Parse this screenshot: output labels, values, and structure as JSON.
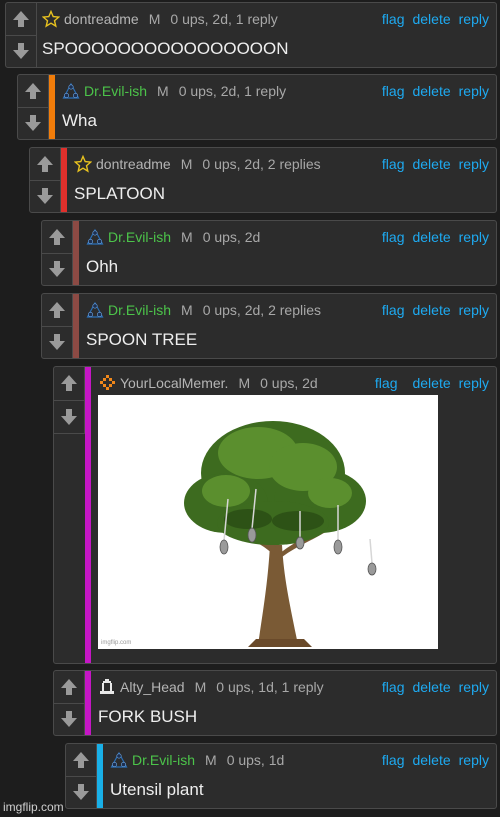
{
  "actions": {
    "flag": "flag",
    "delete": "delete",
    "reply": "reply"
  },
  "colors": {
    "background": "#1d1d1d",
    "panel": "#2c2c2c",
    "link": "#1eaaf1",
    "username_green": "#4cc44a",
    "bar_orange": "#f27d0a",
    "bar_red": "#e0302c",
    "bar_brown": "#8c4a44",
    "bar_magenta": "#c516c5",
    "bar_cyan": "#19b0e8"
  },
  "comments": [
    {
      "user": "dontreadme",
      "role": "M",
      "stats": "0 ups, 2d, 1 reply",
      "text": "SPOOOOOOOOOOOOOOOON",
      "avatar": "star-outline-icon"
    },
    {
      "user": "Dr.Evil-ish",
      "role": "M",
      "stats": "0 ups, 2d, 1 reply",
      "text": "Wha",
      "avatar": "triangle-stars-icon"
    },
    {
      "user": "dontreadme",
      "role": "M",
      "stats": "0 ups, 2d, 2 replies",
      "text": "SPLATOON",
      "avatar": "star-outline-icon"
    },
    {
      "user": "Dr.Evil-ish",
      "role": "M",
      "stats": "0 ups, 2d",
      "text": "Ohh",
      "avatar": "triangle-stars-icon"
    },
    {
      "user": "Dr.Evil-ish",
      "role": "M",
      "stats": "0 ups, 2d, 2 replies",
      "text": "SPOON TREE",
      "avatar": "triangle-stars-icon"
    },
    {
      "user": "YourLocalMemer.",
      "role": "M",
      "stats": "0 ups, 2d",
      "image_watermark": "imgflip.com",
      "avatar": "pixel-diamond-icon"
    },
    {
      "user": "Alty_Head",
      "role": "M",
      "stats": "0 ups, 1d, 1 reply",
      "text": "FORK BUSH",
      "avatar": "pixel-bell-icon"
    },
    {
      "user": "Dr.Evil-ish",
      "role": "M",
      "stats": "0 ups, 1d",
      "text": "Utensil plant",
      "avatar": "triangle-stars-icon"
    }
  ],
  "footer": {
    "watermark": "imgflip.com"
  }
}
